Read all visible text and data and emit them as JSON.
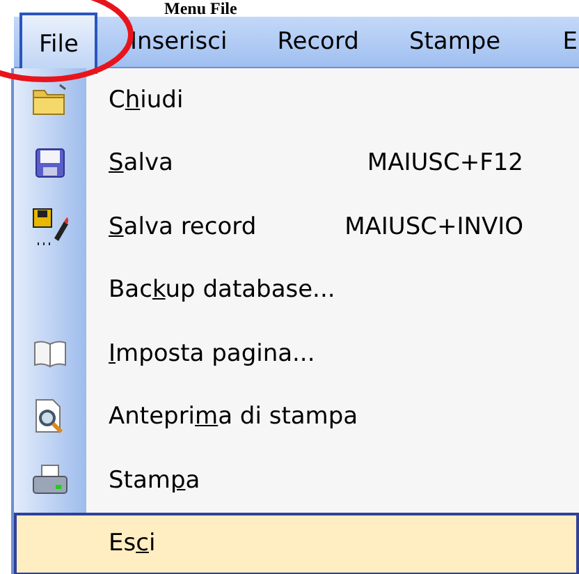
{
  "heading": "Menu File",
  "menu_bar": [
    {
      "label": "File",
      "selected": true
    },
    {
      "label": "Inserisci",
      "selected": false
    },
    {
      "label": "Record",
      "selected": false
    },
    {
      "label": "Stampe",
      "selected": false
    },
    {
      "label": "E",
      "selected": false
    }
  ],
  "menu_items": [
    {
      "label": {
        "before": "C",
        "key": "h",
        "after": "iudi"
      },
      "selected": false
    },
    {
      "label": {
        "key": "S",
        "after": "alva"
      },
      "shortcut": "MAIUSC+F12",
      "selected": false
    },
    {
      "label": {
        "key": "S",
        "after": "alva record"
      },
      "shortcut": "MAIUSC+INVIO",
      "selected": false
    },
    {
      "label": {
        "before": "Bac",
        "key": "k",
        "after": "up database..."
      },
      "selected": false
    },
    {
      "label": {
        "key": "I",
        "after": "mposta pagina..."
      },
      "selected": false
    },
    {
      "label": {
        "before": "Antepri",
        "key": "m",
        "after": "a di stampa"
      },
      "selected": false
    },
    {
      "label": {
        "before": "Stam",
        "key": "p",
        "after": "a"
      },
      "selected": false
    },
    {
      "label": {
        "before": "Es",
        "key": "c",
        "after": "i"
      },
      "selected": true
    }
  ]
}
